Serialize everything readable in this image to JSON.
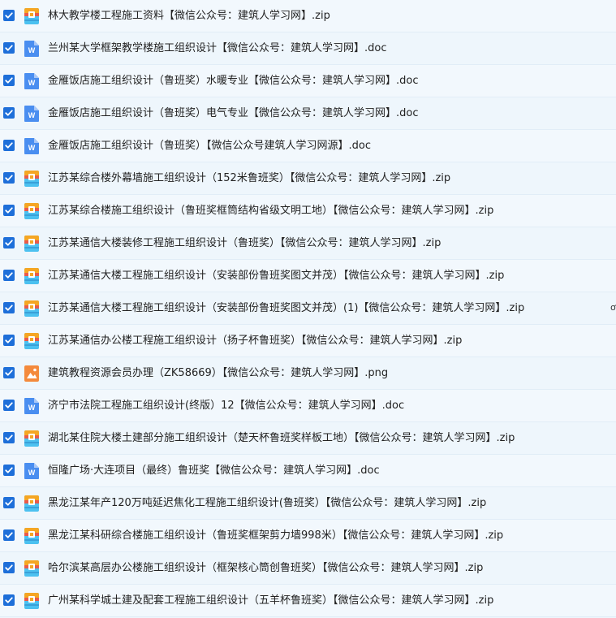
{
  "files": [
    {
      "name": "林大教学楼工程施工资料【微信公众号：建筑人学习网】.zip",
      "type": "zip",
      "checked": true
    },
    {
      "name": "兰州某大学框架教学楼施工组织设计【微信公众号：建筑人学习网】.doc",
      "type": "doc",
      "checked": true
    },
    {
      "name": "金雁饭店施工组织设计（鲁班奖）水暖专业【微信公众号：建筑人学习网】.doc",
      "type": "doc",
      "checked": true
    },
    {
      "name": "金雁饭店施工组织设计（鲁班奖）电气专业【微信公众号：建筑人学习网】.doc",
      "type": "doc",
      "checked": true
    },
    {
      "name": "金雁饭店施工组织设计（鲁班奖）【微信公众号建筑人学习网源】.doc",
      "type": "doc",
      "checked": true
    },
    {
      "name": "江苏某综合楼外幕墙施工组织设计（152米鲁班奖）【微信公众号：建筑人学习网】.zip",
      "type": "zip",
      "checked": true
    },
    {
      "name": "江苏某综合楼施工组织设计（鲁班奖框筒结构省级文明工地）【微信公众号：建筑人学习网】.zip",
      "type": "zip",
      "checked": true
    },
    {
      "name": "江苏某通信大楼装修工程施工组织设计（鲁班奖）【微信公众号：建筑人学习网】.zip",
      "type": "zip",
      "checked": true
    },
    {
      "name": "江苏某通信大楼工程施工组织设计（安装部份鲁班奖图文并茂）【微信公众号：建筑人学习网】.zip",
      "type": "zip",
      "checked": true
    },
    {
      "name": "江苏某通信大楼工程施工组织设计（安装部份鲁班奖图文并茂）(1)【微信公众号：建筑人学习网】.zip",
      "type": "zip",
      "checked": true
    },
    {
      "name": "江苏某通信办公楼工程施工组织设计（扬子杯鲁班奖）【微信公众号：建筑人学习网】.zip",
      "type": "zip",
      "checked": true
    },
    {
      "name": "建筑教程资源会员办理（ZK58669）【微信公众号：建筑人学习网】.png",
      "type": "png",
      "checked": true
    },
    {
      "name": "济宁市法院工程施工组织设计(终版）12【微信公众号：建筑人学习网】.doc",
      "type": "doc",
      "checked": true
    },
    {
      "name": "湖北某住院大楼土建部分施工组织设计（楚天杯鲁班奖样板工地）【微信公众号：建筑人学习网】.zip",
      "type": "zip",
      "checked": true
    },
    {
      "name": "恒隆广场·大连项目（最终）鲁班奖【微信公众号：建筑人学习网】.doc",
      "type": "doc",
      "checked": true
    },
    {
      "name": "黑龙江某年产120万吨延迟焦化工程施工组织设计(鲁班奖）【微信公众号：建筑人学习网】.zip",
      "type": "zip",
      "checked": true
    },
    {
      "name": "黑龙江某科研综合楼施工组织设计（鲁班奖框架剪力墙998米）【微信公众号：建筑人学习网】.zip",
      "type": "zip",
      "checked": true
    },
    {
      "name": "哈尔滨某高层办公楼施工组织设计（框架核心筒创鲁班奖）【微信公众号：建筑人学习网】.zip",
      "type": "zip",
      "checked": true
    },
    {
      "name": "广州某科学城土建及配套工程施工组织设计（五羊杯鲁班奖）【微信公众号：建筑人学习网】.zip",
      "type": "zip",
      "checked": true
    }
  ],
  "colors": {
    "checkbox": "#1e6fd9",
    "doc_icon": "#4a8ef0",
    "zip_icon_top": "#f5a623",
    "zip_icon_bottom": "#4cc1f0",
    "png_icon": "#f48a3c"
  },
  "edge_glyph": "ơ"
}
